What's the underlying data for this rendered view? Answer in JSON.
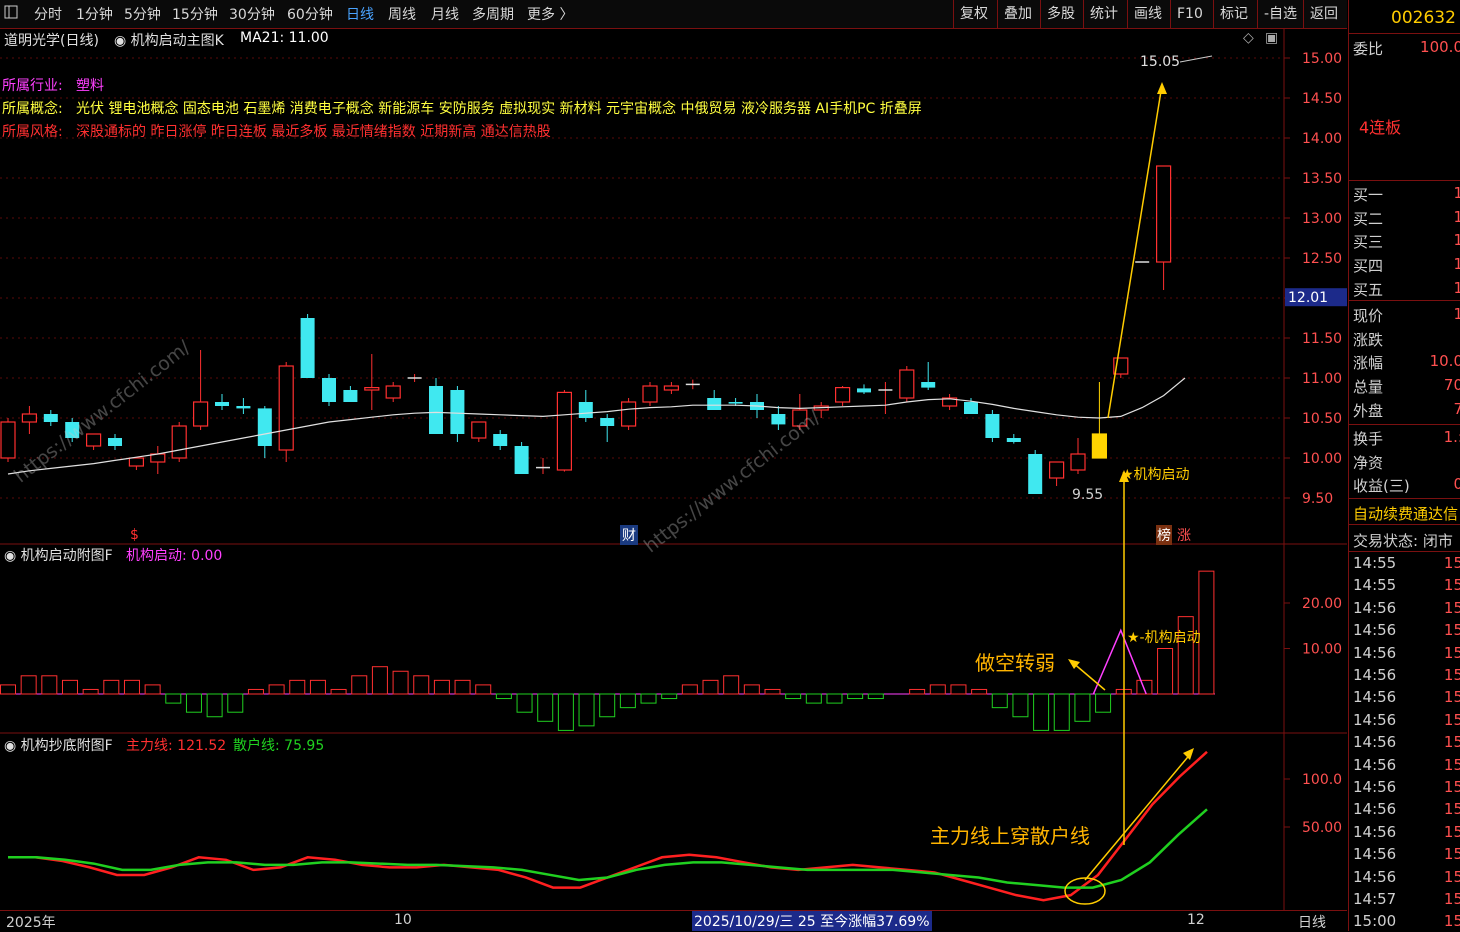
{
  "colors": {
    "up": "#ff3030",
    "down": "#40e8f0",
    "ma": "#e0e0e0",
    "grid": "#7a1010",
    "accent": "#ffb400",
    "main_line": "#ff2020",
    "retail_line": "#20d020",
    "annot": "#ffcc00"
  },
  "toolbar": {
    "left_items": [
      {
        "label": "分时"
      },
      {
        "label": "1分钟"
      },
      {
        "label": "5分钟"
      },
      {
        "label": "15分钟"
      },
      {
        "label": "30分钟"
      },
      {
        "label": "60分钟"
      },
      {
        "label": "日线",
        "active": true
      },
      {
        "label": "周线"
      },
      {
        "label": "月线"
      },
      {
        "label": "多周期"
      },
      {
        "label": "更多 〉"
      }
    ],
    "right_items": [
      "复权",
      "叠加",
      "多股",
      "统计",
      "画线",
      "F10",
      "标记",
      "-自选",
      "返回"
    ],
    "menu_icon": "window-icon"
  },
  "main_header": {
    "stock": "道明光学(日线)",
    "indicator": "机构启动主图K",
    "ma_label": "MA21: 11.00"
  },
  "info": {
    "industry_label": "所属行业:",
    "industry": "塑料",
    "concept_label": "所属概念:",
    "concepts": "光伏 锂电池概念 固态电池 石墨烯 消费电子概念 新能源车 安防服务 虚拟现实 新材料 元宇宙概念 中俄贸易 液冷服务器 AI手机PC 折叠屏",
    "style_label": "所属风格:",
    "styles": "深股通标的 昨日涨停 昨日连板 最近多板 最近情绪指数 近期新高 通达信热股"
  },
  "panel2_header": {
    "name": "机构启动附图F",
    "series": "机构启动: 0.00"
  },
  "panel3_header": {
    "name": "机构抄底附图F",
    "main_label": "主力线: 121.52",
    "retail_label": "散户线: 75.95"
  },
  "annotations": {
    "launch_main": "★机构启动",
    "launch_sub": "★-机构启动",
    "short_weak": "做空转弱",
    "cross": "主力线上穿散户线",
    "low_price": "9.55",
    "high_price": "15.05",
    "marker_s": "$",
    "marker_cai": "财",
    "marker_bang": "榜",
    "marker_zhang": "涨",
    "watermark": "https://www.cfchi.com/"
  },
  "price_axis": {
    "ticks": [
      "15.00",
      "14.50",
      "14.00",
      "13.50",
      "13.00",
      "12.50",
      "12.00",
      "11.50",
      "11.00",
      "10.50",
      "10.00",
      "9.50"
    ],
    "current": "12.01"
  },
  "sub1_axis": {
    "ticks": [
      "20.00",
      "10.00"
    ]
  },
  "sub2_axis": {
    "ticks": [
      "100.0",
      "50.00"
    ]
  },
  "date_axis": {
    "labels": [
      "2025年",
      "10",
      "12"
    ],
    "status": "2025/10/29/三 25 至今涨幅37.69%",
    "period": "日线"
  },
  "right_panel": {
    "code": "002632",
    "weibi_label": "委比",
    "weibi_value": "100.0",
    "board": "4连板",
    "buy_labels": [
      "买一",
      "买二",
      "买三",
      "买四",
      "买五"
    ],
    "buy_values": [
      "1",
      "1",
      "1",
      "1",
      "1"
    ],
    "stats_labels": [
      "现价",
      "涨跌",
      "涨幅",
      "总量",
      "外盘"
    ],
    "stats_values": [
      "1",
      "",
      "10.0",
      "70",
      "7"
    ],
    "extra_labels": [
      "换手",
      "净资",
      "收益(三)"
    ],
    "extra_values": [
      "1.:",
      "",
      "0"
    ],
    "fee_text": "自动续费通达信",
    "trade_status": "交易状态: 闭市",
    "times": [
      "14:55",
      "14:55",
      "14:56",
      "14:56",
      "14:56",
      "14:56",
      "14:56",
      "14:56",
      "14:56",
      "14:56",
      "14:56",
      "14:56",
      "14:56",
      "14:56",
      "14:56",
      "14:57",
      "15:00"
    ],
    "time_values": [
      "15",
      "15",
      "15",
      "15",
      "15",
      "15",
      "15",
      "15",
      "15",
      "15",
      "15",
      "15",
      "15",
      "15",
      "15",
      "15",
      "15"
    ]
  },
  "chart_data": {
    "type": "candlestick",
    "ylim": [
      9.3,
      15.2
    ],
    "candles": [
      {
        "o": 10.0,
        "h": 10.5,
        "l": 9.95,
        "c": 10.45
      },
      {
        "o": 10.45,
        "h": 10.65,
        "l": 10.3,
        "c": 10.55
      },
      {
        "o": 10.55,
        "h": 10.6,
        "l": 10.4,
        "c": 10.45
      },
      {
        "o": 10.45,
        "h": 10.5,
        "l": 10.2,
        "c": 10.25
      },
      {
        "o": 10.15,
        "h": 10.3,
        "l": 10.1,
        "c": 10.3
      },
      {
        "o": 10.25,
        "h": 10.3,
        "l": 10.1,
        "c": 10.15
      },
      {
        "o": 9.9,
        "h": 10.0,
        "l": 9.85,
        "c": 10.0
      },
      {
        "o": 9.95,
        "h": 10.15,
        "l": 9.8,
        "c": 10.05
      },
      {
        "o": 10.0,
        "h": 10.45,
        "l": 9.95,
        "c": 10.4
      },
      {
        "o": 10.4,
        "h": 11.35,
        "l": 10.35,
        "c": 10.7
      },
      {
        "o": 10.7,
        "h": 10.8,
        "l": 10.6,
        "c": 10.65
      },
      {
        "o": 10.65,
        "h": 10.75,
        "l": 10.55,
        "c": 10.62
      },
      {
        "o": 10.62,
        "h": 10.65,
        "l": 10.0,
        "c": 10.15
      },
      {
        "o": 10.1,
        "h": 11.2,
        "l": 9.95,
        "c": 11.15
      },
      {
        "o": 11.75,
        "h": 11.8,
        "l": 11.0,
        "c": 11.0
      },
      {
        "o": 11.0,
        "h": 11.05,
        "l": 10.65,
        "c": 10.7
      },
      {
        "o": 10.85,
        "h": 10.9,
        "l": 10.7,
        "c": 10.7
      },
      {
        "o": 10.85,
        "h": 11.3,
        "l": 10.6,
        "c": 10.88
      },
      {
        "o": 10.75,
        "h": 10.95,
        "l": 10.7,
        "c": 10.9
      },
      {
        "o": 11.0,
        "h": 11.05,
        "l": 10.95,
        "c": 11.0
      },
      {
        "o": 10.9,
        "h": 11.0,
        "l": 10.3,
        "c": 10.3
      },
      {
        "o": 10.85,
        "h": 10.9,
        "l": 10.2,
        "c": 10.3
      },
      {
        "o": 10.25,
        "h": 10.45,
        "l": 10.2,
        "c": 10.45
      },
      {
        "o": 10.3,
        "h": 10.35,
        "l": 10.1,
        "c": 10.15
      },
      {
        "o": 10.15,
        "h": 10.2,
        "l": 9.8,
        "c": 9.8
      },
      {
        "o": 9.88,
        "h": 10.0,
        "l": 9.8,
        "c": 9.88
      },
      {
        "o": 9.85,
        "h": 10.85,
        "l": 9.83,
        "c": 10.82
      },
      {
        "o": 10.7,
        "h": 10.85,
        "l": 10.45,
        "c": 10.5
      },
      {
        "o": 10.5,
        "h": 10.55,
        "l": 10.2,
        "c": 10.4
      },
      {
        "o": 10.4,
        "h": 10.75,
        "l": 10.35,
        "c": 10.7
      },
      {
        "o": 10.7,
        "h": 10.95,
        "l": 10.65,
        "c": 10.9
      },
      {
        "o": 10.85,
        "h": 10.95,
        "l": 10.8,
        "c": 10.9
      },
      {
        "o": 10.92,
        "h": 10.98,
        "l": 10.86,
        "c": 10.92
      },
      {
        "o": 10.75,
        "h": 10.85,
        "l": 10.6,
        "c": 10.6
      },
      {
        "o": 10.7,
        "h": 10.75,
        "l": 10.65,
        "c": 10.68
      },
      {
        "o": 10.7,
        "h": 10.8,
        "l": 10.5,
        "c": 10.6
      },
      {
        "o": 10.55,
        "h": 10.65,
        "l": 10.35,
        "c": 10.42
      },
      {
        "o": 10.4,
        "h": 10.8,
        "l": 10.35,
        "c": 10.6
      },
      {
        "o": 10.6,
        "h": 10.7,
        "l": 10.5,
        "c": 10.65
      },
      {
        "o": 10.7,
        "h": 10.9,
        "l": 10.65,
        "c": 10.88
      },
      {
        "o": 10.87,
        "h": 10.92,
        "l": 10.8,
        "c": 10.82
      },
      {
        "o": 10.85,
        "h": 10.95,
        "l": 10.55,
        "c": 10.85
      },
      {
        "o": 10.75,
        "h": 11.15,
        "l": 10.7,
        "c": 11.1
      },
      {
        "o": 10.95,
        "h": 11.2,
        "l": 10.85,
        "c": 10.88
      },
      {
        "o": 10.65,
        "h": 10.8,
        "l": 10.6,
        "c": 10.75
      },
      {
        "o": 10.7,
        "h": 10.75,
        "l": 10.55,
        "c": 10.55
      },
      {
        "o": 10.55,
        "h": 10.6,
        "l": 10.2,
        "c": 10.25
      },
      {
        "o": 10.25,
        "h": 10.3,
        "l": 10.18,
        "c": 10.2
      },
      {
        "o": 10.05,
        "h": 10.1,
        "l": 9.55,
        "c": 9.55
      },
      {
        "o": 9.75,
        "h": 9.95,
        "l": 9.65,
        "c": 9.95
      },
      {
        "o": 9.85,
        "h": 10.25,
        "l": 9.8,
        "c": 10.05
      },
      {
        "o": 10.0,
        "h": 10.95,
        "l": 10.0,
        "c": 10.3
      },
      {
        "o": 11.05,
        "h": 11.25,
        "l": 11.0,
        "c": 11.25
      },
      {
        "o": 12.45,
        "h": 12.45,
        "l": 12.45,
        "c": 12.45
      },
      {
        "o": 12.45,
        "h": 13.65,
        "l": 12.1,
        "c": 13.65
      }
    ],
    "ma": [
      9.8,
      9.84,
      9.87,
      9.9,
      9.93,
      9.97,
      10.01,
      10.05,
      10.1,
      10.15,
      10.2,
      10.25,
      10.3,
      10.35,
      10.4,
      10.45,
      10.48,
      10.51,
      10.54,
      10.56,
      10.57,
      10.56,
      10.55,
      10.54,
      10.53,
      10.52,
      10.54,
      10.56,
      10.58,
      10.61,
      10.63,
      10.64,
      10.66,
      10.66,
      10.66,
      10.65,
      10.63,
      10.62,
      10.63,
      10.64,
      10.65,
      10.66,
      10.7,
      10.73,
      10.74,
      10.71,
      10.67,
      10.62,
      10.58,
      10.54,
      10.51,
      10.5,
      10.52,
      10.63,
      10.78,
      11.0
    ],
    "launch_bars": [
      2,
      4,
      4,
      3,
      1,
      3,
      3,
      2,
      -2,
      -4,
      -5,
      -4,
      1,
      2,
      3,
      3,
      1,
      4,
      6,
      5,
      4,
      3,
      3,
      2,
      -1,
      -4,
      -6,
      -8,
      -7,
      -5,
      -3,
      -2,
      -1,
      2,
      3,
      4,
      2,
      1,
      -1,
      -2,
      -2,
      -1,
      -1,
      0,
      1,
      2,
      2,
      1,
      -3,
      -5,
      -8,
      -8,
      -6,
      -4,
      1,
      3,
      10,
      17,
      27
    ],
    "launch_line": [
      0,
      0,
      0,
      0,
      0,
      0,
      0,
      0,
      0,
      0,
      0,
      0,
      0,
      0,
      0,
      0,
      0,
      0,
      0,
      0,
      0,
      0,
      0,
      0,
      0,
      0,
      0,
      0,
      0,
      0,
      0,
      0,
      0,
      0,
      0,
      0,
      0,
      0,
      0,
      0,
      0,
      0,
      0,
      0,
      0,
      0,
      0,
      0,
      0,
      0,
      0,
      14,
      0,
      0
    ],
    "main_line": [
      38,
      38,
      35,
      30,
      24,
      24,
      30,
      38,
      36,
      28,
      30,
      38,
      36,
      32,
      30,
      30,
      32,
      30,
      28,
      22,
      14,
      14,
      22,
      30,
      38,
      40,
      38,
      34,
      30,
      28,
      30,
      32,
      30,
      28,
      26,
      20,
      14,
      8,
      4,
      8,
      24,
      52,
      80,
      102,
      121.52
    ],
    "retail_line": [
      38,
      38,
      36,
      33,
      28,
      28,
      32,
      34,
      34,
      32,
      32,
      34,
      34,
      33,
      32,
      32,
      31,
      30,
      28,
      24,
      20,
      22,
      28,
      32,
      34,
      34,
      32,
      30,
      28,
      28,
      28,
      28,
      26,
      24,
      22,
      18,
      16,
      14,
      14,
      20,
      34,
      56,
      75.95
    ],
    "sub2_ylim": [
      0,
      135
    ]
  }
}
